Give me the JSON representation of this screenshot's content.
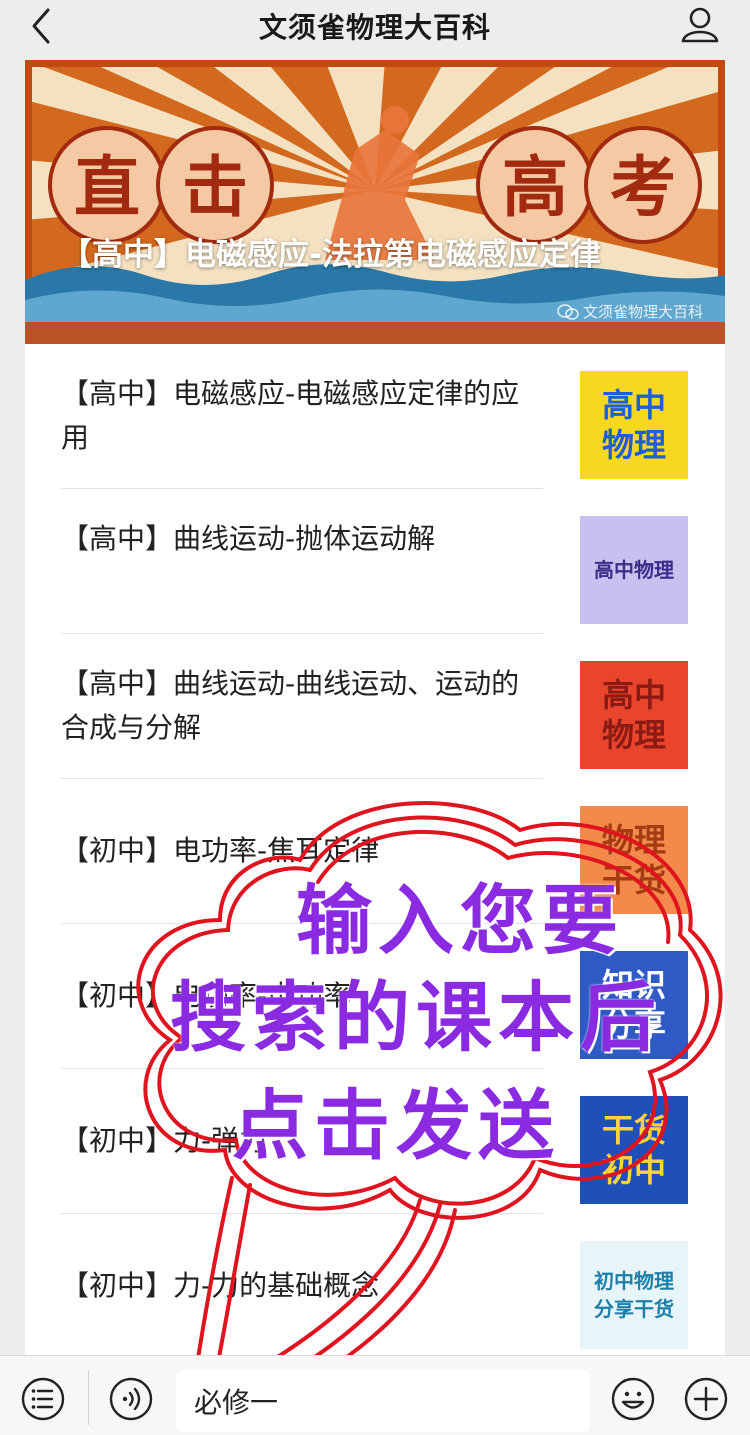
{
  "header": {
    "title": "文须雀物理大百科",
    "back_icon": "chevron-left-icon",
    "profile_icon": "user-icon"
  },
  "banner": {
    "badge_left": [
      "直",
      "击"
    ],
    "badge_right": [
      "高",
      "考"
    ],
    "title": "【高中】电磁感应-法拉第电磁感应定律",
    "watermark": "文须雀物理大百科",
    "colors": {
      "sunburst_a": "#d2691e",
      "sunburst_b": "#f4e1c1",
      "badge": "#f4c9a4",
      "badge_text": "#a12a0f"
    }
  },
  "articles": [
    {
      "title": "【高中】电磁感应-电磁感应定律的应用",
      "thumb": {
        "lines": [
          "高中",
          "物理"
        ],
        "bg": "#f7d81e",
        "fg": "#1e5fd6"
      }
    },
    {
      "title": "【高中】曲线运动-抛体运动解",
      "thumb": {
        "lines": [
          "高中物理"
        ],
        "bg": "#c7c1f0",
        "fg": "#3b2c8a"
      }
    },
    {
      "title": "【高中】曲线运动-曲线运动、运动的合成与分解",
      "thumb": {
        "lines": [
          "高中",
          "物理"
        ],
        "bg": "#e8452c",
        "fg": "#8a1a14"
      }
    },
    {
      "title": "【初中】电功率-焦耳定律",
      "thumb": {
        "lines": [
          "物理",
          "干货"
        ],
        "bg": "#f18a4a",
        "fg": "#a53b12"
      }
    },
    {
      "title": "【初中】电功率-电功率",
      "thumb": {
        "lines": [
          "知识",
          "分享"
        ],
        "bg": "#2f59c4",
        "fg": "#ffffff"
      }
    },
    {
      "title": "【初中】力-弹力",
      "thumb": {
        "lines": [
          "干货",
          "初中"
        ],
        "bg": "#1f4fb8",
        "fg": "#ffd43b"
      }
    },
    {
      "title": "【初中】力-力的基础概念",
      "thumb": {
        "lines": [
          "初中物理",
          "分享干货"
        ],
        "bg": "#e8f5f8",
        "fg": "#1d7fa8"
      }
    }
  ],
  "overlay": {
    "lines": [
      "输入您要",
      "搜索的课本后",
      "点击发送"
    ],
    "color": "#8a2be2",
    "bubble_color": "#e0141f"
  },
  "bottombar": {
    "input_value": "必修一",
    "menu_icon": "list-menu-icon",
    "voice_icon": "voice-icon",
    "emoji_icon": "emoji-icon",
    "plus_icon": "plus-circle-icon"
  }
}
